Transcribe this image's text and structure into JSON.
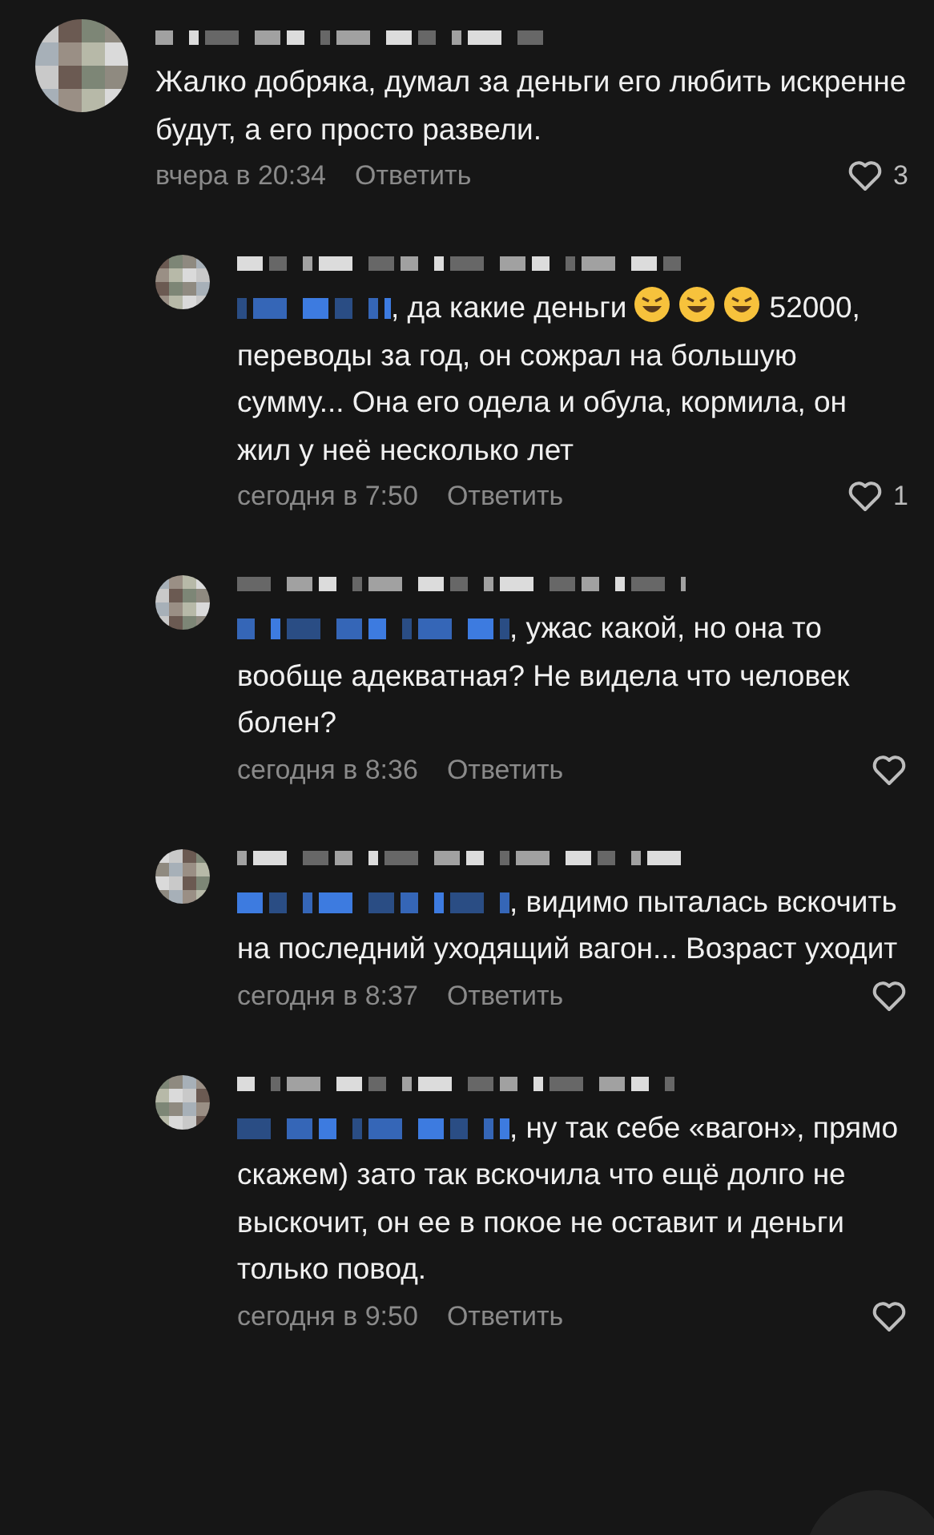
{
  "comments": [
    {
      "parts": [
        {
          "kind": "text",
          "text": "Жалко добряка, думал за деньги его любить искренне будут, а его просто развели."
        }
      ],
      "time": "вчера в 20:34",
      "reply": "Ответить",
      "likes": "3",
      "replies": [
        {
          "parts": [
            {
              "kind": "mention"
            },
            {
              "kind": "text",
              "text": ", да какие деньги"
            },
            {
              "kind": "emoji"
            },
            {
              "kind": "emoji"
            },
            {
              "kind": "emoji"
            },
            {
              "kind": "text",
              "text": " 52000, переводы за год, он сожрал на большую сумму... Она его одела и обула, кормила, он жил у неё несколько лет"
            }
          ],
          "time": "сегодня в 7:50",
          "reply": "Ответить",
          "likes": "1"
        },
        {
          "parts": [
            {
              "kind": "mention"
            },
            {
              "kind": "text",
              "text": ", ужас какой, но она то вообще адекватная? Не видела что человек болен?"
            }
          ],
          "time": "сегодня в 8:36",
          "reply": "Ответить"
        },
        {
          "parts": [
            {
              "kind": "mention"
            },
            {
              "kind": "text",
              "text": ", видимо пыталась вскочить на последний уходящий вагон... Возраст уходит"
            }
          ],
          "time": "сегодня в 8:37",
          "reply": "Ответить"
        },
        {
          "parts": [
            {
              "kind": "mention"
            },
            {
              "kind": "text",
              "text": ", ну так себе «вагон», прямо скажем) зато так вскочила что ещё долго не выскочит, он ее в покое не оставит и деньги только повод."
            }
          ],
          "time": "сегодня в 9:50",
          "reply": "Ответить"
        }
      ]
    }
  ]
}
